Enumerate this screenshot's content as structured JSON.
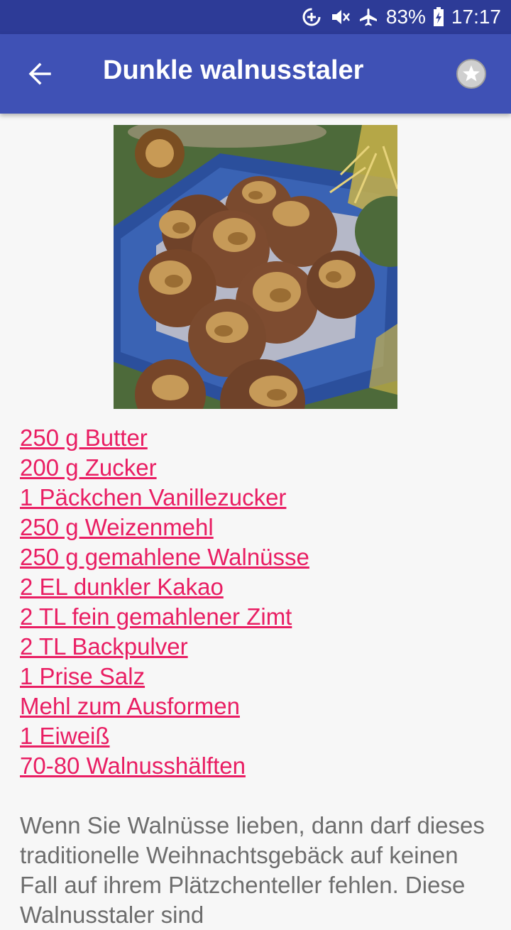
{
  "status_bar": {
    "battery": "83%",
    "time": "17:17"
  },
  "app_bar": {
    "title": "Dunkle walnusstaler"
  },
  "recipe": {
    "ingredients": [
      "250 g Butter",
      "200 g Zucker",
      "1 Päckchen Vanillezucker",
      "250 g Weizenmehl",
      "250 g gemahlene Walnüsse",
      "2 EL dunkler Kakao",
      "2 TL fein gemahlener Zimt",
      "2 TL Backpulver",
      "1 Prise Salz",
      "Mehl zum Ausformen",
      "1 Eiweiß",
      "70-80 Walnusshälften"
    ],
    "description": "Wenn Sie Walnüsse lieben, dann darf dieses traditionelle Weihnachtsgebäck auf keinen Fall auf ihrem Plätzchenteller fehlen. Diese Walnusstaler sind"
  },
  "colors": {
    "status_bar": "#2d3b97",
    "app_bar": "#3f51b5",
    "link": "#e91e63",
    "body_text": "#6d6d6d"
  },
  "icons": [
    "data-saver-icon",
    "vibrate-mute-icon",
    "airplane-icon",
    "battery-charging-icon",
    "back-arrow-icon",
    "star-icon"
  ]
}
